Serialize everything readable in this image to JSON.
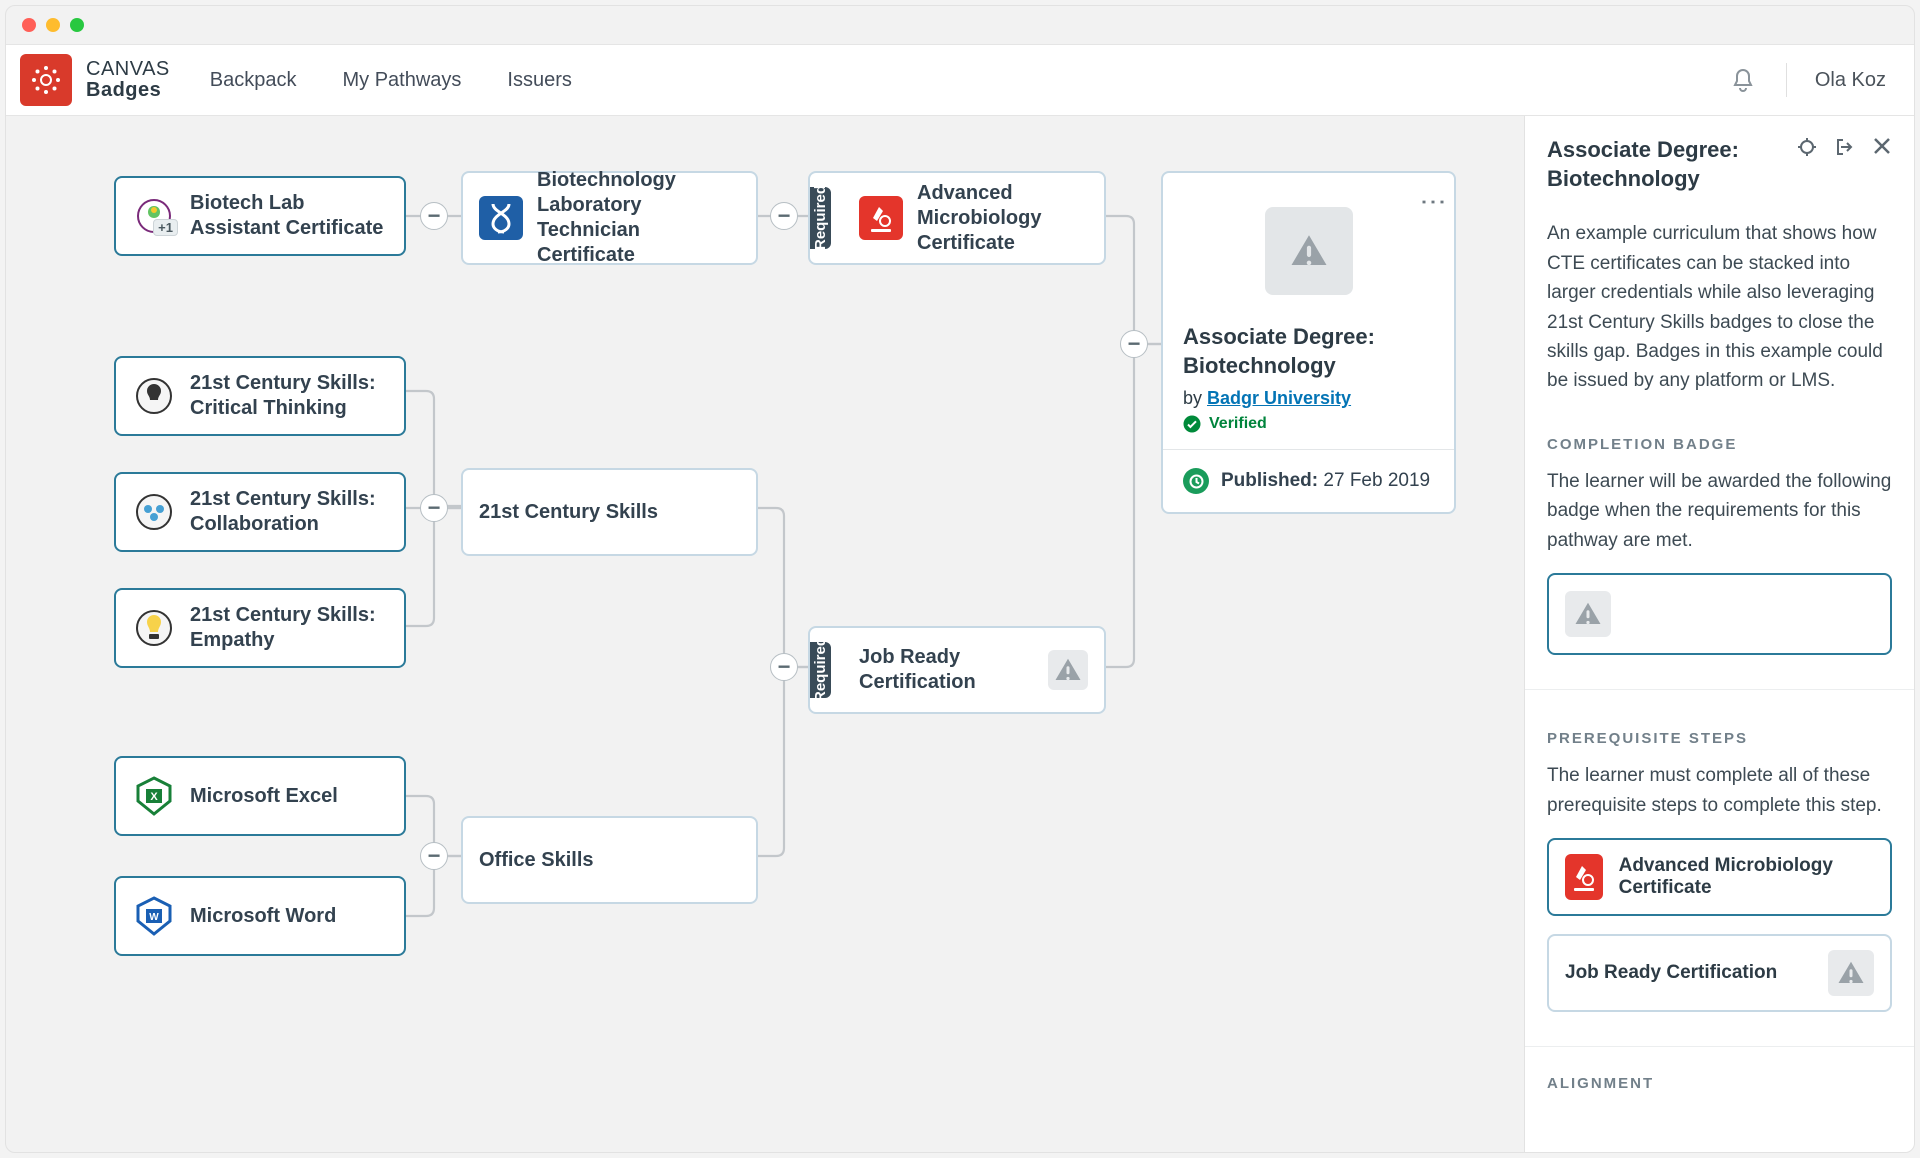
{
  "brand": {
    "line1": "CANVAS",
    "line2": "Badges"
  },
  "nav": {
    "backpack": "Backpack",
    "pathways": "My Pathways",
    "issuers": "Issuers"
  },
  "user": {
    "name": "Ola Koz"
  },
  "nodes": {
    "biotech_assistant": "Biotech Lab Assistant Certificate",
    "biotech_assistant_extra": "+1",
    "biotech_tech": "Biotechnology Laboratory Technician Certificate",
    "adv_micro": "Advanced Microbiology Certificate",
    "crit_think": "21st Century Skills: Critical Thinking",
    "collab": "21st Century Skills: Collaboration",
    "empathy": "21st Century Skills: Empathy",
    "skills21": "21st Century Skills",
    "excel": "Microsoft Excel",
    "word": "Microsoft Word",
    "office": "Office Skills",
    "job_ready": "Job Ready Certification",
    "required": "Required"
  },
  "pathway": {
    "title": "Associate Degree: Biotechnology",
    "by_prefix": "by ",
    "issuer": "Badgr University",
    "verified": "Verified",
    "published_label": "Published",
    "published_date": "27 Feb 2019"
  },
  "sidebar": {
    "title": "Associate Degree: Biotechnology",
    "description": "An example curriculum that shows how CTE certificates can be stacked into larger credentials while also leveraging 21st Century Skills badges to close the skills gap. Badges in this example could be issued by any platform or LMS.",
    "completion_title": "COMPLETION BADGE",
    "completion_text": "The learner will be awarded the following badge when the requirements for this pathway are met.",
    "prereq_title": "PREREQUISITE STEPS",
    "prereq_text": "The learner must complete all of these prerequisite steps to complete this step.",
    "prereq1": "Advanced Microbiology Certificate",
    "prereq2": "Job Ready Certification",
    "alignment_title": "ALIGNMENT"
  }
}
